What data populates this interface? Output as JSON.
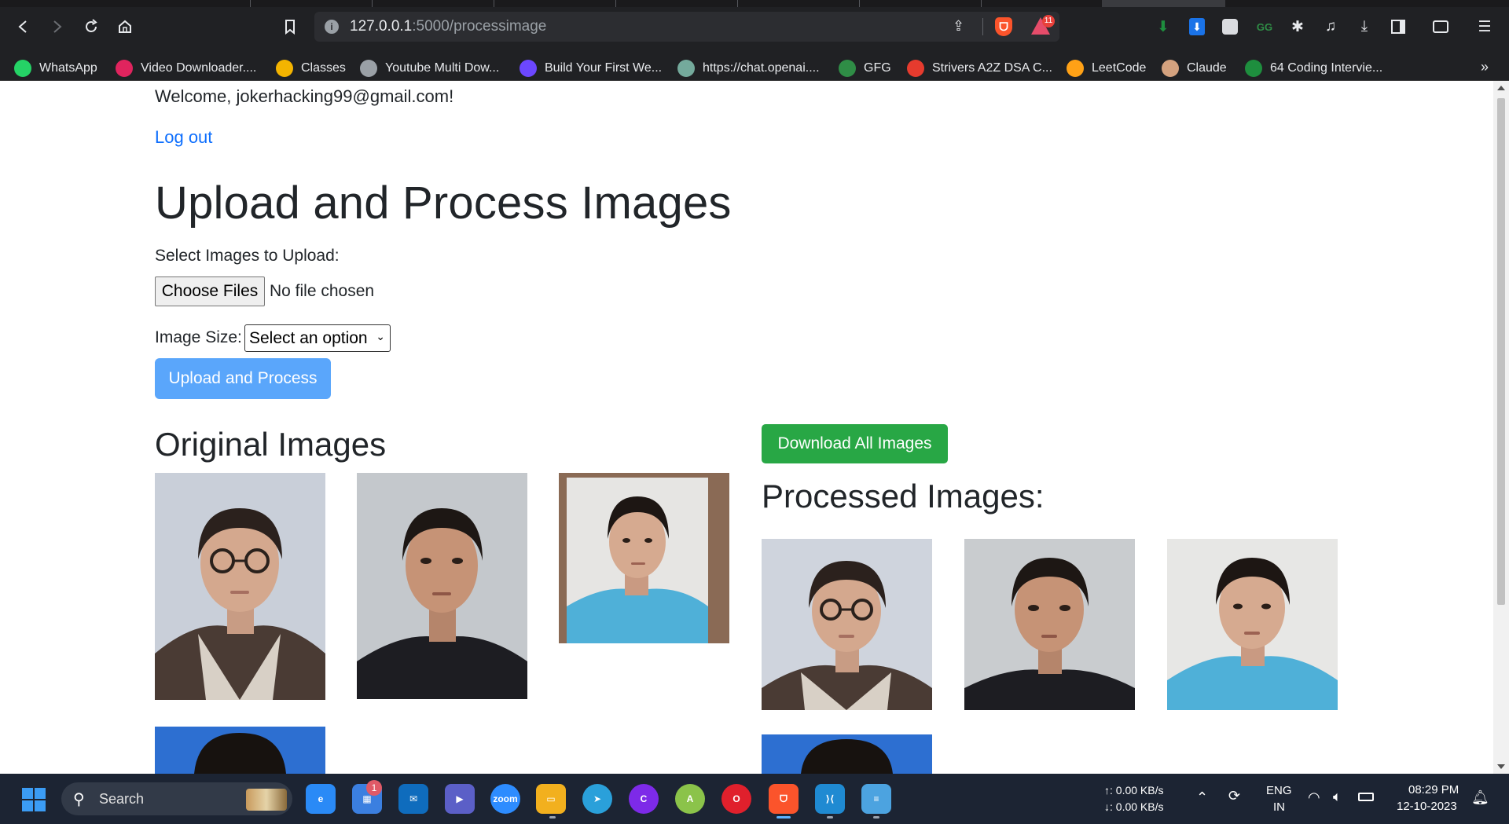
{
  "browser": {
    "url_host": "127.0.0.1",
    "url_path": ":5000/processimage",
    "rewards_badge": "11",
    "bookmarks": [
      {
        "label": "WhatsApp",
        "icon": "whatsapp-icon",
        "color": "#25d366"
      },
      {
        "label": "Video Downloader....",
        "icon": "video-downloader-icon",
        "color": "#e0245e"
      },
      {
        "label": "Classes",
        "icon": "classroom-icon",
        "color": "#f4b400"
      },
      {
        "label": "Youtube Multi Dow...",
        "icon": "globe-icon",
        "color": "#9aa0a6"
      },
      {
        "label": "Build Your First We...",
        "icon": "build-icon",
        "color": "#6c47ff"
      },
      {
        "label": "https://chat.openai....",
        "icon": "openai-icon",
        "color": "#74aa9c"
      },
      {
        "label": "GFG",
        "icon": "gfg-icon",
        "color": "#2f8d46"
      },
      {
        "label": "Strivers A2Z DSA C...",
        "icon": "tuf-icon",
        "color": "#e63b2e"
      },
      {
        "label": "LeetCode",
        "icon": "leetcode-icon",
        "color": "#ffa116"
      },
      {
        "label": "Claude",
        "icon": "anthropic-icon",
        "color": "#d4a27f"
      },
      {
        "label": "64 Coding Intervie...",
        "icon": "bookmark-page-icon",
        "color": "#1e8e3e"
      }
    ]
  },
  "page": {
    "welcome": "Welcome, jokerhacking99@gmail.com!",
    "logout": "Log out",
    "heading": "Upload and Process Images",
    "select_label": "Select Images to Upload:",
    "choose_files": "Choose Files",
    "file_status": "No file chosen",
    "size_label": "Image Size:",
    "size_selected": "Select an option",
    "upload_button": "Upload and Process",
    "original_heading": "Original Images",
    "download_button": "Download All Images",
    "processed_heading": "Processed Images:"
  },
  "colors": {
    "link": "#0d6efd",
    "primary_button": "#5aa6fb",
    "success_button": "#28a745"
  },
  "taskbar": {
    "search": "Search",
    "notification_count": "1",
    "net_up": "↑: 0.00 KB/s",
    "net_down": "↓: 0.00 KB/s",
    "lang": "ENG",
    "region": "IN",
    "time": "08:29 PM",
    "date": "12-10-2023"
  }
}
